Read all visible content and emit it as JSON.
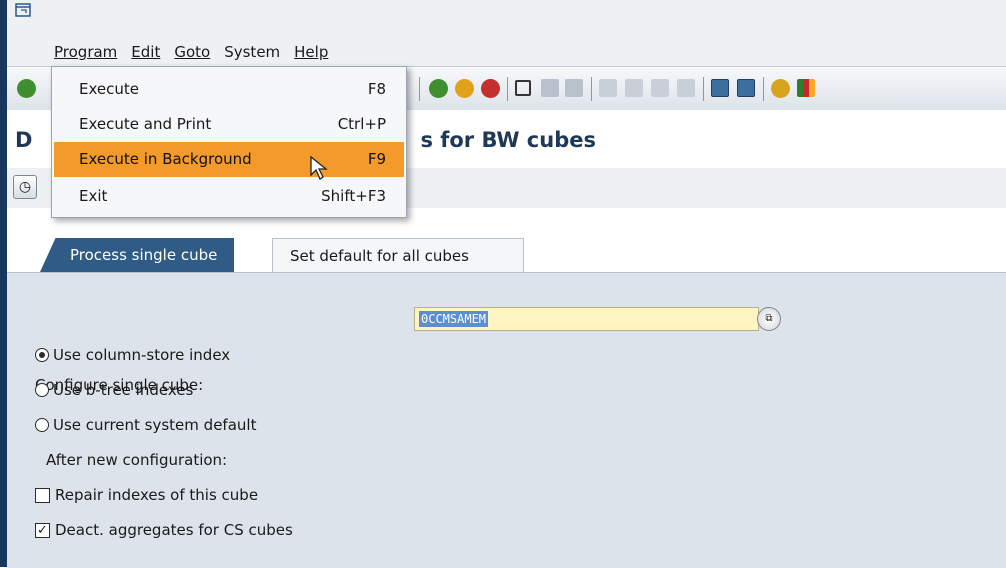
{
  "menubar": {
    "items": [
      {
        "label": "Program",
        "accel": "P"
      },
      {
        "label": "Edit",
        "accel": "E"
      },
      {
        "label": "Goto",
        "accel": "G"
      },
      {
        "label": "System",
        "accel": "y"
      },
      {
        "label": "Help",
        "accel": "H"
      }
    ]
  },
  "program_menu": {
    "items": [
      {
        "label": "Execute",
        "shortcut": "F8"
      },
      {
        "label": "Execute and Print",
        "shortcut": "Ctrl+P"
      },
      {
        "label": "Execute in Background",
        "shortcut": "F9"
      },
      {
        "label": "Exit",
        "shortcut": "Shift+F3"
      }
    ],
    "highlighted_index": 2
  },
  "screen": {
    "title_prefix": "D",
    "title_suffix": "s for BW cubes"
  },
  "tabs": [
    {
      "label": "Process single cube",
      "active": true
    },
    {
      "label": "Set default for all cubes",
      "active": false
    }
  ],
  "form": {
    "cube_label": "Configure single cube:",
    "cube_value": "0CCMSAMEM",
    "radio_options": [
      {
        "label": "Use column-store index",
        "selected": true
      },
      {
        "label": "Use b-tree indexes",
        "selected": false
      },
      {
        "label": "Use current system default",
        "selected": false
      }
    ],
    "after_label": "After new configuration:",
    "checkboxes": [
      {
        "label": "Repair indexes of this cube",
        "checked": false
      },
      {
        "label": "Deact. aggregates for CS cubes",
        "checked": true
      }
    ]
  },
  "colors": {
    "menu_highlight": "#f39a2b",
    "active_tab": "#2f5b85",
    "input_bg": "#fff5c2",
    "title_text": "#1f3855"
  }
}
